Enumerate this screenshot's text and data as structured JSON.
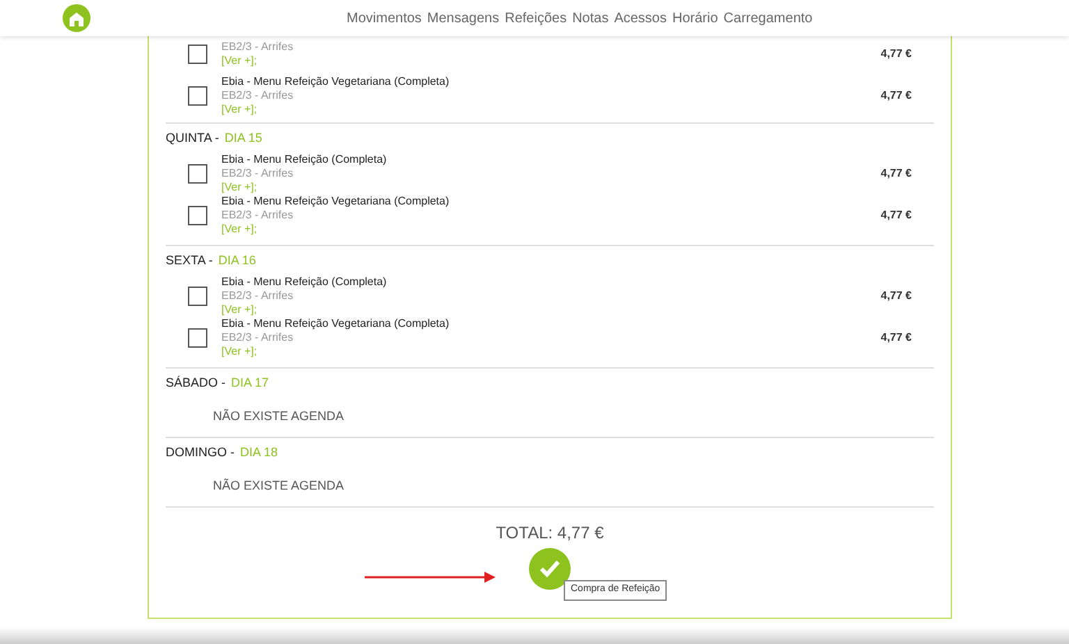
{
  "nav": {
    "items": [
      "Movimentos",
      "Mensagens",
      "Refeições",
      "Notas",
      "Acessos",
      "Horário",
      "Carregamento"
    ]
  },
  "top_items": [
    {
      "school": "EB2/3 - Arrifes",
      "link": "[Ver +];",
      "price": "4,77 €",
      "checked": false
    },
    {
      "title": "Ebia - Menu Refeição Vegetariana (Completa)",
      "school": "EB2/3 - Arrifes",
      "link": "[Ver +];",
      "price": "4,77 €",
      "checked": false
    }
  ],
  "days": [
    {
      "weekday": "QUINTA -",
      "date": "DIA 15",
      "items": [
        {
          "title": "Ebia - Menu Refeição (Completa)",
          "school": "EB2/3 - Arrifes",
          "link": "[Ver +];",
          "price": "4,77 €",
          "checked": false
        },
        {
          "title": "Ebia - Menu Refeição Vegetariana (Completa)",
          "school": "EB2/3 - Arrifes",
          "link": "[Ver +];",
          "price": "4,77 €",
          "checked": false
        }
      ]
    },
    {
      "weekday": "SEXTA -",
      "date": "DIA 16",
      "items": [
        {
          "title": "Ebia - Menu Refeição (Completa)",
          "school": "EB2/3 - Arrifes",
          "link": "[Ver +];",
          "price": "4,77 €",
          "checked": false
        },
        {
          "title": "Ebia - Menu Refeição Vegetariana (Completa)",
          "school": "EB2/3 - Arrifes",
          "link": "[Ver +];",
          "price": "4,77 €",
          "checked": false
        }
      ]
    },
    {
      "weekday": "SÁBADO -",
      "date": "DIA 17",
      "empty_text": "NÃO EXISTE AGENDA"
    },
    {
      "weekday": "DOMINGO -",
      "date": "DIA 18",
      "empty_text": "NÃO EXISTE AGENDA"
    }
  ],
  "total": "TOTAL: 4,77 €",
  "confirm_button": {
    "tooltip": "Compra de Refeição"
  }
}
